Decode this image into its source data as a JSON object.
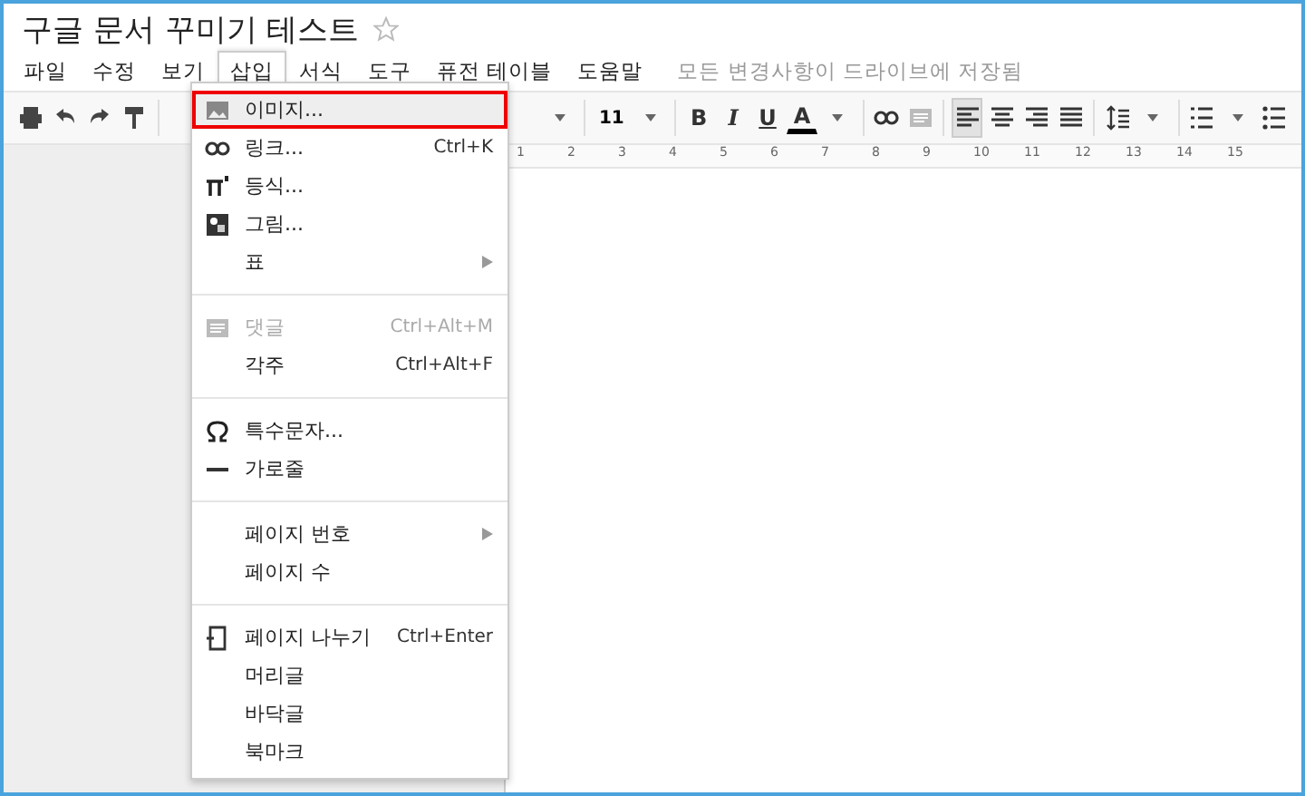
{
  "document": {
    "title": "구글 문서 꾸미기 테스트",
    "starred": false
  },
  "menu_bar": [
    {
      "label": "파일",
      "selected": false
    },
    {
      "label": "수정",
      "selected": false
    },
    {
      "label": "보기",
      "selected": false
    },
    {
      "label": "삽입",
      "selected": true
    },
    {
      "label": "서식",
      "selected": false
    },
    {
      "label": "도구",
      "selected": false
    },
    {
      "label": "퓨전 테이블",
      "selected": false
    },
    {
      "label": "도움말",
      "selected": false
    }
  ],
  "save_status": "모든 변경사항이 드라이브에 저장됨",
  "toolbar": {
    "font_size": "11",
    "format_buttons": [
      {
        "label": "B"
      },
      {
        "label": "I"
      },
      {
        "label": "U"
      },
      {
        "label": "A"
      }
    ],
    "alignment": [
      {
        "selected": true
      },
      {
        "selected": false
      },
      {
        "selected": false
      },
      {
        "selected": false
      }
    ]
  },
  "ruler": [
    "1",
    "2",
    "3",
    "4",
    "5",
    "6",
    "7",
    "8",
    "9",
    "10",
    "11",
    "12",
    "13",
    "14",
    "15"
  ],
  "insert_menu": [
    {
      "kind": "item",
      "label": "이미지...",
      "selected": true,
      "disabled": false
    },
    {
      "kind": "item",
      "label": "링크...",
      "shortcut": "Ctrl+K",
      "selected": false,
      "disabled": false
    },
    {
      "kind": "item",
      "label": "등식...",
      "selected": false,
      "disabled": false
    },
    {
      "kind": "item",
      "label": "그림...",
      "selected": false,
      "disabled": false
    },
    {
      "kind": "submenu",
      "label": "표",
      "selected": false,
      "disabled": false
    },
    {
      "kind": "separator"
    },
    {
      "kind": "item",
      "label": "댓글",
      "shortcut": "Ctrl+Alt+M",
      "selected": false,
      "disabled": true
    },
    {
      "kind": "item",
      "label": "각주",
      "shortcut": "Ctrl+Alt+F",
      "selected": false,
      "disabled": false
    },
    {
      "kind": "separator"
    },
    {
      "kind": "item",
      "label": "특수문자...",
      "selected": false,
      "disabled": false
    },
    {
      "kind": "item",
      "label": "가로줄",
      "selected": false,
      "disabled": false
    },
    {
      "kind": "separator"
    },
    {
      "kind": "submenu",
      "label": "페이지 번호",
      "selected": false,
      "disabled": false
    },
    {
      "kind": "item",
      "label": "페이지 수",
      "selected": false,
      "disabled": false
    },
    {
      "kind": "separator"
    },
    {
      "kind": "item",
      "label": "페이지 나누기",
      "shortcut": "Ctrl+Enter",
      "selected": false,
      "disabled": false
    },
    {
      "kind": "item",
      "label": "머리글",
      "selected": false,
      "disabled": false
    },
    {
      "kind": "item",
      "label": "바닥글",
      "selected": false,
      "disabled": false
    },
    {
      "kind": "item",
      "label": "북마크",
      "selected": false,
      "disabled": false
    }
  ]
}
